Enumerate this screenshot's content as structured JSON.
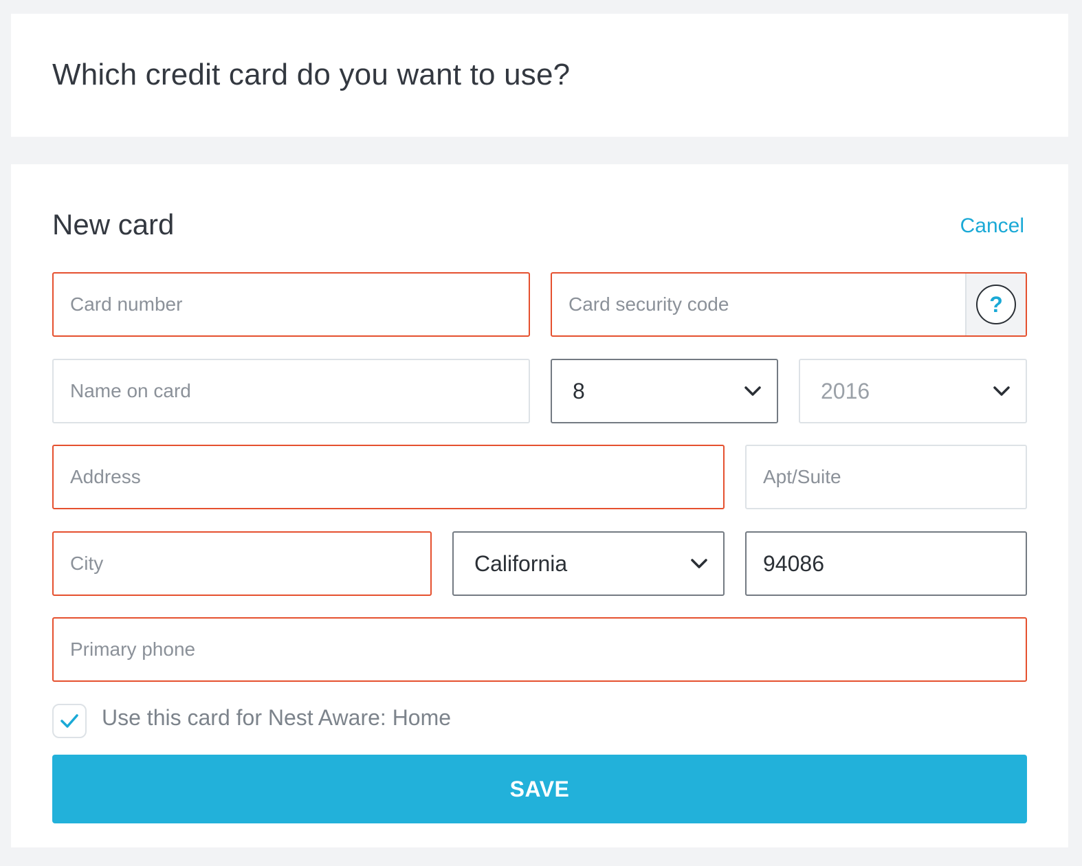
{
  "question": "Which credit card do you want to use?",
  "form": {
    "title": "New card",
    "cancel_label": "Cancel",
    "card_number": {
      "placeholder": "Card number",
      "value": ""
    },
    "security_code": {
      "placeholder": "Card security code",
      "value": "",
      "help_label": "?"
    },
    "name_on_card": {
      "placeholder": "Name on card",
      "value": ""
    },
    "exp_month": {
      "value": "8"
    },
    "exp_year": {
      "value": "2016"
    },
    "address": {
      "placeholder": "Address",
      "value": ""
    },
    "apt_suite": {
      "placeholder": "Apt/Suite",
      "value": ""
    },
    "city": {
      "placeholder": "City",
      "value": ""
    },
    "state": {
      "value": "California"
    },
    "zip": {
      "value": "94086"
    },
    "phone": {
      "placeholder": "Primary phone",
      "value": ""
    },
    "nest_aware_checkbox": {
      "label": "Use this card for Nest Aware: Home",
      "checked": true
    },
    "save_label": "SAVE"
  },
  "colors": {
    "accent": "#22b1da",
    "error_border": "#e5502e",
    "default_border": "#dde2e6",
    "filled_border": "#737a82",
    "background": "#f2f3f5"
  },
  "icons": {
    "help": "question-circle-icon",
    "dropdown": "chevron-down-icon",
    "check": "checkmark-icon"
  }
}
